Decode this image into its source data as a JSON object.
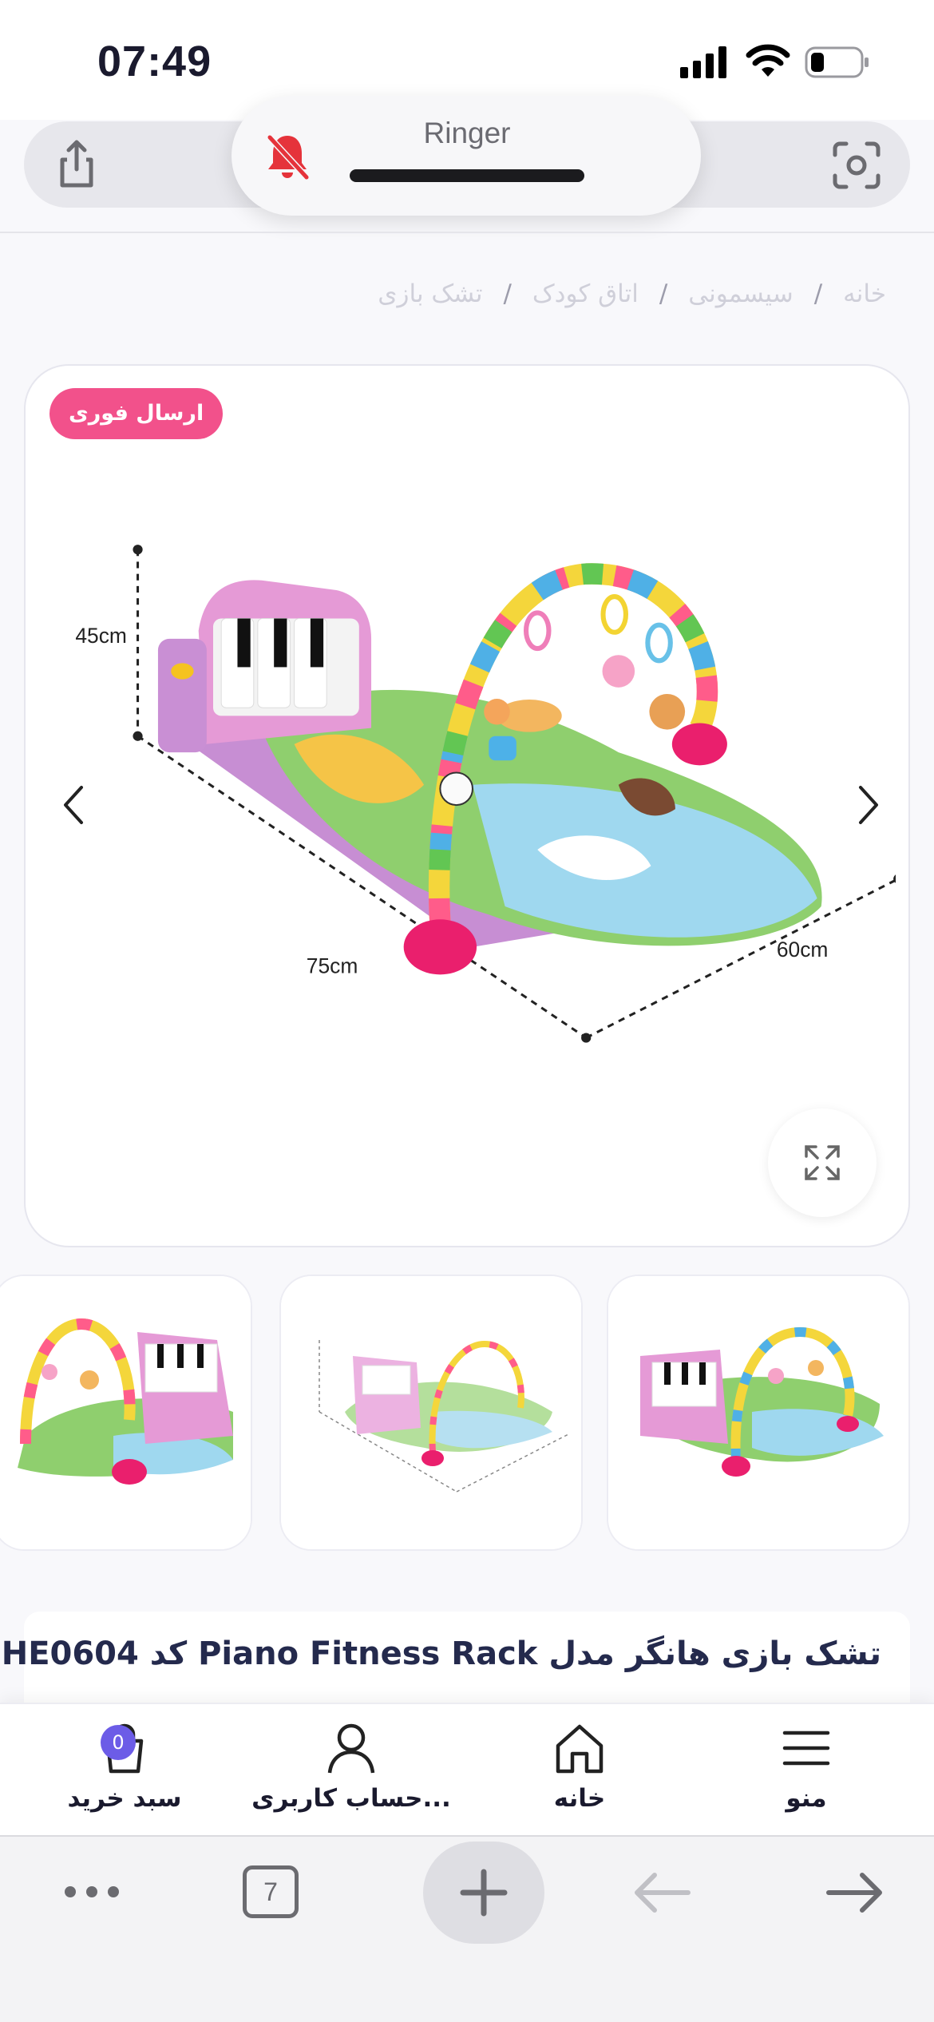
{
  "status_bar": {
    "time": "07:49"
  },
  "ringer": {
    "label": "Ringer"
  },
  "breadcrumb": {
    "items": [
      "خانه",
      "سیسمونی",
      "اتاق کودک",
      "تشک بازی"
    ],
    "separator": "/"
  },
  "gallery": {
    "badge": "ارسال فوری",
    "dimensions": {
      "height": "45cm",
      "length": "75cm",
      "width": "60cm"
    }
  },
  "product": {
    "title": "تشک بازی هانگر مدل Piano Fitness Rack کد HE0604"
  },
  "bottom_nav": {
    "items": [
      {
        "label": "سبد خرید",
        "icon": "bag-icon",
        "count": "0"
      },
      {
        "label": "حساب کاربری...",
        "icon": "user-icon"
      },
      {
        "label": "خانه",
        "icon": "home-icon"
      },
      {
        "label": "منو",
        "icon": "menu-icon"
      }
    ]
  },
  "browser": {
    "tab_count": "7"
  },
  "colors": {
    "badge": "#f2518b",
    "accent": "#6c5ce7",
    "title": "#242a4d"
  }
}
